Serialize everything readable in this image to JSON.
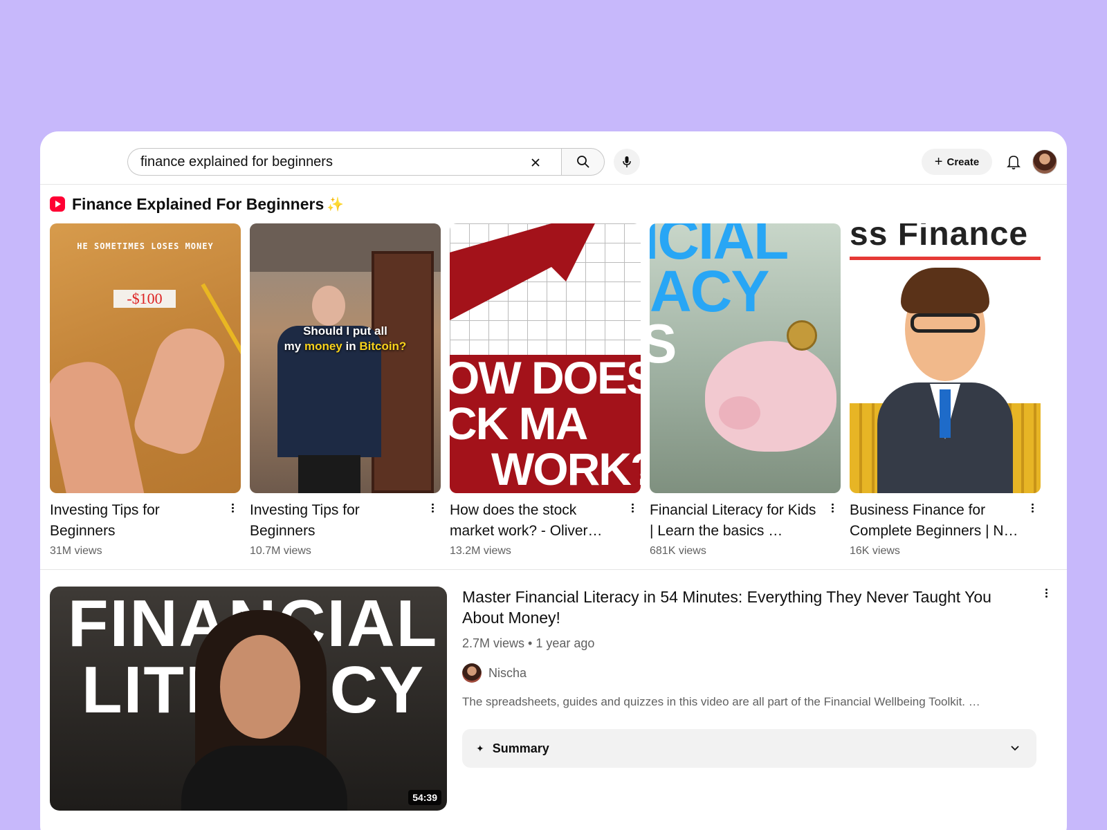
{
  "search": {
    "value": "finance explained for beginners",
    "icons": {
      "clear": "close-icon",
      "search": "search-icon",
      "mic": "mic-icon"
    }
  },
  "header": {
    "create_label": "Create",
    "icons": {
      "create": "plus-icon",
      "notifications": "bell-icon"
    }
  },
  "shelf": {
    "title": "Finance Explained For Beginners",
    "sparkle": "✨",
    "icon": "shorts-icon",
    "items": [
      {
        "title": "Investing Tips for Beginners",
        "views": "31M views",
        "thumb_caption": "HE SOMETIMES LOSES MONEY",
        "thumb_note": "-$100"
      },
      {
        "title": "Investing Tips for Beginners",
        "views": "10.7M views",
        "thumb_caption_a": "Should I put all",
        "thumb_caption_b1": "my ",
        "thumb_caption_b2": "money",
        "thumb_caption_b3": " in ",
        "thumb_caption_b4": "Bitcoin?"
      },
      {
        "title": "How does the stock market work? - Oliver…",
        "views": "13.2M views",
        "thumb_line1": "OW DOES",
        "thumb_line2": "CK MA",
        "thumb_line3": "WORK?"
      },
      {
        "title": "Financial Literacy for Kids | Learn the basics …",
        "views": "681K views",
        "thumb_line1": "ICIAL",
        "thumb_line2": "ACY",
        "thumb_line3": "S"
      },
      {
        "title": "Business Finance for Complete Beginners | N…",
        "views": "16K views",
        "thumb_top": "ss Finance"
      }
    ]
  },
  "result": {
    "title": "Master Financial Literacy in 54 Minutes: Everything They Never Taught You About Money!",
    "meta": "2.7M views • 1 year ago",
    "channel": "Nischa",
    "description": "The spreadsheets, guides and quizzes in this video are all part of the Financial Wellbeing Toolkit. …",
    "duration": "54:39",
    "thumb_line1": "FINANCIAL",
    "thumb_line2": "LITERACY",
    "summary_label": "Summary",
    "summary_spark": "✦",
    "summary_chevron": "chevron-down-icon"
  },
  "colors": {
    "page_bg": "#c7b8fb",
    "accent_red": "#ff0033",
    "text_primary": "#0f0f0f",
    "text_secondary": "#606060"
  }
}
